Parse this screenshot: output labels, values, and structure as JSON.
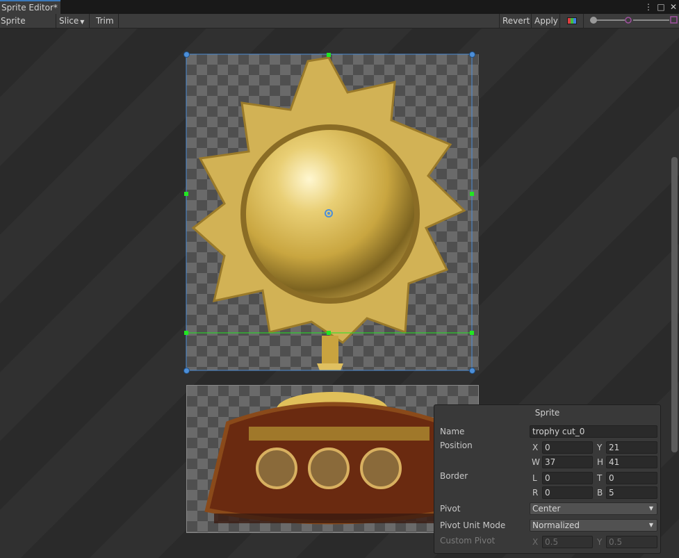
{
  "window": {
    "tab_title": "Sprite Editor*",
    "controls": [
      "⋮",
      "□",
      "✕"
    ]
  },
  "toolbar": {
    "mode_label": "Sprite Editor",
    "slice_label": "Slice",
    "trim_label": "Trim",
    "revert_label": "Revert",
    "apply_label": "Apply",
    "color_icon": "rgb-channel-icon",
    "zoom_level": 0.1,
    "mip_level": 0.55
  },
  "sprite_panel": {
    "title": "Sprite",
    "name_label": "Name",
    "name_value": "trophy cut_0",
    "position_label": "Position",
    "x_label": "X",
    "x_value": "0",
    "y_label": "Y",
    "y_value": "21",
    "w_label": "W",
    "w_value": "37",
    "h_label": "H",
    "h_value": "41",
    "border_label": "Border",
    "l_label": "L",
    "l_value": "0",
    "t_label": "T",
    "t_value": "0",
    "r_label": "R",
    "r_value": "0",
    "b_label": "B",
    "b_value": "5",
    "pivot_label": "Pivot",
    "pivot_value": "Center",
    "pivot_unit_label": "Pivot Unit Mode",
    "pivot_unit_value": "Normalized",
    "custom_pivot_label": "Custom Pivot",
    "cx_label": "X",
    "cx_value": "0.5",
    "cy_label": "Y",
    "cy_value": "0.5"
  },
  "colors": {
    "selection": "#4d8fd8",
    "border_handles": "#22e622",
    "gold": "#d9b54a",
    "base_brown": "#6a2a10"
  }
}
